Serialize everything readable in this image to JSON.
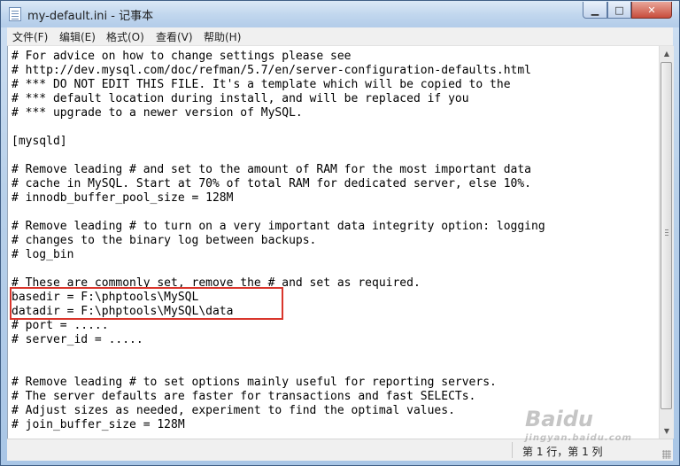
{
  "window": {
    "title": "my-default.ini - 记事本",
    "controls": {
      "minimize": "▁",
      "maximize": "□",
      "close": "✕"
    }
  },
  "menubar": {
    "items": [
      "文件(F)",
      "编辑(E)",
      "格式(O)",
      "查看(V)",
      "帮助(H)"
    ]
  },
  "editor": {
    "lines": [
      "# For advice on how to change settings please see",
      "# http://dev.mysql.com/doc/refman/5.7/en/server-configuration-defaults.html",
      "# *** DO NOT EDIT THIS FILE. It's a template which will be copied to the",
      "# *** default location during install, and will be replaced if you",
      "# *** upgrade to a newer version of MySQL.",
      "",
      "[mysqld]",
      "",
      "# Remove leading # and set to the amount of RAM for the most important data",
      "# cache in MySQL. Start at 70% of total RAM for dedicated server, else 10%.",
      "# innodb_buffer_pool_size = 128M",
      "",
      "# Remove leading # to turn on a very important data integrity option: logging",
      "# changes to the binary log between backups.",
      "# log_bin",
      "",
      "# These are commonly set, remove the # and set as required.",
      "basedir = F:\\phptools\\MySQL",
      "datadir = F:\\phptools\\MySQL\\data",
      "# port = .....",
      "# server_id = .....",
      "",
      "",
      "# Remove leading # to set options mainly useful for reporting servers.",
      "# The server defaults are faster for transactions and fast SELECTs.",
      "# Adjust sizes as needed, experiment to find the optimal values.",
      "# join_buffer_size = 128M"
    ],
    "highlight_color": "#d9362c"
  },
  "statusbar": {
    "position": "第 1 行，第 1 列"
  },
  "watermark": {
    "text": "Baidu",
    "sub": "jingyan.baidu.com"
  }
}
